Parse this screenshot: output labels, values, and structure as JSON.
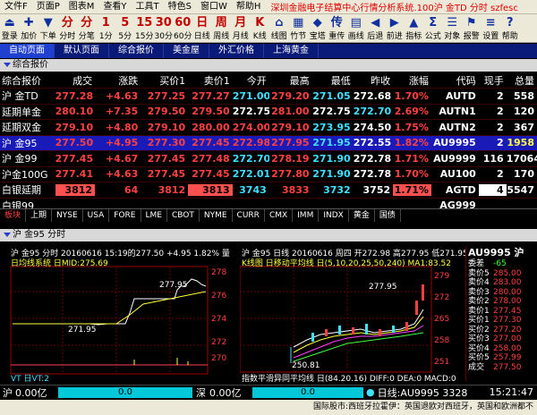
{
  "menubar": {
    "items": [
      "文件F",
      "页面P",
      "图表M",
      "查看Y",
      "工具T",
      "特色S",
      "窗口W",
      "帮助H"
    ],
    "title": "深圳金融电子结算中心行情分析系统.100沪  金TD 分时  szfesc",
    "right": [
      "沪",
      "金TD",
      "分时",
      "szfesc"
    ]
  },
  "toolbar": [
    {
      "glyph": "⏏",
      "label": "登录"
    },
    {
      "glyph": "✚",
      "label": "加价"
    },
    {
      "glyph": "▼",
      "label": "下单"
    },
    {
      "glyph": "分",
      "label": "分时"
    },
    {
      "glyph": "分",
      "label": "分笔"
    },
    {
      "glyph": "1",
      "label": "1分"
    },
    {
      "glyph": "5",
      "label": "5分"
    },
    {
      "glyph": "15",
      "label": "15分"
    },
    {
      "glyph": "30",
      "label": "30分"
    },
    {
      "glyph": "60",
      "label": "60分"
    },
    {
      "glyph": "日",
      "label": "日线"
    },
    {
      "glyph": "周",
      "label": "周线"
    },
    {
      "glyph": "月",
      "label": "月线"
    },
    {
      "glyph": "K",
      "label": "K线"
    },
    {
      "glyph": "⌂",
      "label": "线图"
    },
    {
      "glyph": "▦",
      "label": "竹节"
    },
    {
      "glyph": "◆",
      "label": "宝塔"
    },
    {
      "glyph": "传",
      "label": "重传"
    },
    {
      "glyph": "▤",
      "label": "画线"
    },
    {
      "glyph": "◀",
      "label": "后退"
    },
    {
      "glyph": "▶",
      "label": "前进"
    },
    {
      "glyph": "▲",
      "label": "指标"
    },
    {
      "glyph": "Σ",
      "label": "公式"
    },
    {
      "glyph": "☰",
      "label": "对象"
    },
    {
      "glyph": "⚑",
      "label": "报警"
    },
    {
      "glyph": "≡",
      "label": "设置"
    },
    {
      "glyph": "?",
      "label": "帮助"
    }
  ],
  "tabs": [
    {
      "label": "自动页面",
      "active": true
    },
    {
      "label": "默认页面",
      "active": false
    },
    {
      "label": "综合报价",
      "active": false
    },
    {
      "label": "美金屋",
      "active": false
    },
    {
      "label": "外汇价格",
      "active": false
    },
    {
      "label": "上海黄金",
      "active": false
    }
  ],
  "panel_title": "综合报价",
  "quote_headers": [
    "综合报价",
    "成交",
    "涨跌",
    "买价1",
    "卖价1",
    "今开",
    "最高",
    "最低",
    "昨收",
    "涨幅",
    "代码",
    "现手",
    "总量"
  ],
  "quote_rows": [
    {
      "name": "沪 金TD",
      "cells": [
        "277.28",
        "+4.63",
        "277.25",
        "277.27",
        "271.00",
        "279.20",
        "271.05",
        "272.68",
        "1.70%",
        "AUTD",
        "2",
        "558"
      ],
      "colors": [
        "red",
        "red",
        "red",
        "red",
        "cyan",
        "red",
        "cyan",
        "white",
        "red",
        "white",
        "white",
        "white"
      ]
    },
    {
      "name": "延期单金",
      "cells": [
        "280.10",
        "+7.35",
        "279.50",
        "279.50",
        "272.75",
        "281.00",
        "272.75",
        "272.70",
        "2.69%",
        "AUTN1",
        "2",
        "120"
      ],
      "colors": [
        "red",
        "red",
        "red",
        "red",
        "white",
        "red",
        "white",
        "cyan",
        "red",
        "white",
        "white",
        "white"
      ]
    },
    {
      "name": "延期双金",
      "cells": [
        "279.10",
        "+4.80",
        "279.10",
        "280.00",
        "274.00",
        "279.10",
        "273.95",
        "274.50",
        "1.75%",
        "AUTN2",
        "2",
        "367"
      ],
      "colors": [
        "red",
        "red",
        "red",
        "red",
        "red",
        "red",
        "cyan",
        "white",
        "red",
        "white",
        "white",
        "white"
      ]
    },
    {
      "name": "沪 金95",
      "cells": [
        "277.50",
        "+4.95",
        "277.30",
        "277.45",
        "272.98",
        "277.95",
        "271.95",
        "272.55",
        "1.82%",
        "AU9995",
        "2",
        "1958"
      ],
      "colors": [
        "red",
        "red",
        "red",
        "red",
        "red",
        "red",
        "cyan",
        "white",
        "red",
        "white",
        "white",
        "yellow"
      ],
      "selected": true
    },
    {
      "name": "沪 金99",
      "cells": [
        "277.45",
        "+4.67",
        "277.45",
        "277.48",
        "272.70",
        "278.19",
        "271.90",
        "272.78",
        "1.71%",
        "AU9999",
        "116",
        "17064"
      ],
      "colors": [
        "red",
        "red",
        "red",
        "red",
        "cyan",
        "red",
        "cyan",
        "white",
        "red",
        "white",
        "white",
        "white"
      ]
    },
    {
      "name": "沪金100G",
      "cells": [
        "277.41",
        "+4.63",
        "277.45",
        "277.45",
        "272.01",
        "277.80",
        "271.90",
        "272.78",
        "1.70%",
        "AU100",
        "2",
        "170"
      ],
      "colors": [
        "red",
        "red",
        "red",
        "red",
        "cyan",
        "red",
        "cyan",
        "white",
        "red",
        "white",
        "white",
        "white"
      ]
    },
    {
      "name": "白银延期",
      "cells": [
        "3812",
        "64",
        "3812",
        "3813",
        "3743",
        "3833",
        "3732",
        "3752",
        "1.71%",
        "AGTD",
        "4",
        "5547"
      ],
      "colors": [
        "redbg",
        "red",
        "red",
        "redbg",
        "cyan",
        "red",
        "cyan",
        "white",
        "redbg",
        "white",
        "whitebg",
        "white"
      ]
    },
    {
      "name": "白银99",
      "cells": [
        "",
        "",
        "",
        "",
        "",
        "",
        "",
        "",
        "",
        "AG999",
        "",
        ""
      ],
      "colors": [
        "white",
        "white",
        "white",
        "white",
        "white",
        "white",
        "white",
        "white",
        "white",
        "white",
        "white",
        "white"
      ]
    }
  ],
  "subtabs": [
    "板块",
    "上期",
    "NYSE",
    "USA",
    "FORE",
    "LME",
    "CBOT",
    "NYME",
    "CURR",
    "CMX",
    "IMM",
    "INDX",
    "黄金",
    "国债"
  ],
  "lower_title": "沪  金95 分时",
  "chart1": {
    "header": "沪  金95 分时  20160616 15:19的277.50  +4.95 1.82% 量",
    "sub": "日均线系统 日MID:275.69",
    "label_high": "277.95",
    "label_low": "271.95",
    "yticks": [
      "278",
      "276",
      "274",
      "272",
      "270"
    ],
    "footer": "VT 日VT:2"
  },
  "chart2": {
    "header": "沪  金95 日线 20160616 周四 开272.98 高277.95 低271.95 收",
    "sub": "K线图 日移动平均线 日(5,10,20,25,50,240) MA1:83.52",
    "label_high": "277.95",
    "label_low": "250.81",
    "yticks": [
      "279",
      "272",
      "265",
      "258",
      "251"
    ],
    "footer": "指数平滑异同平均线 日(84.20.16) DIFF:0 DEA:0 MACD:0"
  },
  "quotebox": {
    "title": "AU9995 沪",
    "rows": [
      {
        "l": "委差",
        "v": "-65"
      },
      {
        "l": "卖价5",
        "v": "285.00"
      },
      {
        "l": "卖价4",
        "v": "283.00"
      },
      {
        "l": "卖价3",
        "v": "280.00"
      },
      {
        "l": "卖价2",
        "v": "278.00"
      },
      {
        "l": "卖价1",
        "v": "277.45"
      },
      {
        "l": "买价1",
        "v": "277.30"
      },
      {
        "l": "买价2",
        "v": "277.20"
      },
      {
        "l": "买价3",
        "v": "277.00"
      },
      {
        "l": "买价4",
        "v": "258.00"
      },
      {
        "l": "买价5",
        "v": "257.99"
      },
      {
        "l": "成交",
        "v": "277.50"
      }
    ]
  },
  "status": {
    "hu": "沪",
    "hu_val": "0.00亿",
    "hu_box": "0.0",
    "shen": "深",
    "shen_val": "0.00亿",
    "shen_box": "0.0",
    "ticker": "日线:AU9995 3328",
    "time": "15:21:47"
  },
  "infobar": "国际股市:西班牙拉霍伊：英国退欧对西班牙，英国和欧洲都不"
}
